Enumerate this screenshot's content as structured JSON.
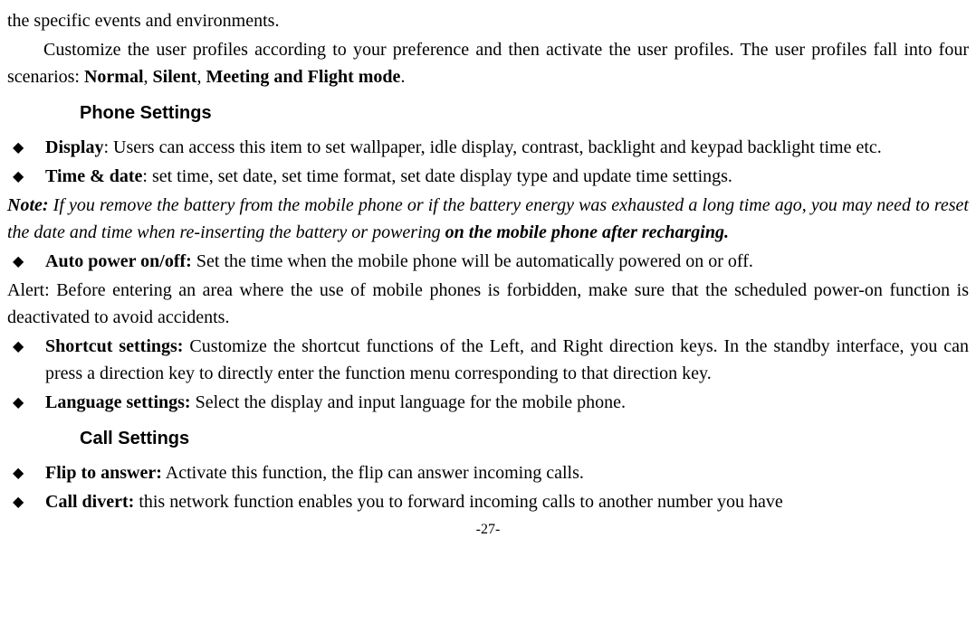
{
  "line1": "the specific events and environments.",
  "para1_a": "Customize the user profiles according to your preference and then activate the user profiles. The user profiles fall into four scenarios: ",
  "para1_b": "Normal",
  "para1_c": ", ",
  "para1_d": "Silent",
  "para1_e": ", ",
  "para1_f": "Meeting and Flight mode",
  "para1_g": ".",
  "headingA": "Phone Settings",
  "b1_label": "Display",
  "b1_text": ": Users can access this item to set wallpaper, idle display, contrast, backlight and keypad backlight time etc.",
  "b2_label": "Time & date",
  "b2_text": ": set time, set date, set time format, set date display type and update time settings.",
  "note_label": "Note:",
  "note_a": " If you remove the battery from the mobile phone or if the battery energy was exhausted a long time ago, you may need to reset the date and time when re-inserting the battery or powering ",
  "note_b": "on the mobile phone after recharging.",
  "b3_label": "Auto power on/off:",
  "b3_text": " Set the time when the mobile phone will be automatically powered on or off.",
  "alert": "Alert: Before entering an area where the use of mobile phones is forbidden, make sure that the scheduled power-on function is deactivated to avoid accidents.",
  "b4_label": "Shortcut settings:",
  "b4_text": " Customize the shortcut functions of the Left, and Right direction keys. In the standby interface, you can press a direction key to directly enter the function menu corresponding to that direction key.",
  "b5_label": "Language settings:",
  "b5_text": " Select the display and input language for the mobile phone.",
  "headingB": "Call Settings",
  "b6_label": "Flip to answer:",
  "b6_text": " Activate this function, the flip can answer incoming calls.",
  "b7_label": "Call divert:",
  "b7_text": " this network function enables you to forward incoming calls to another number you have",
  "pagenum": "-27-"
}
